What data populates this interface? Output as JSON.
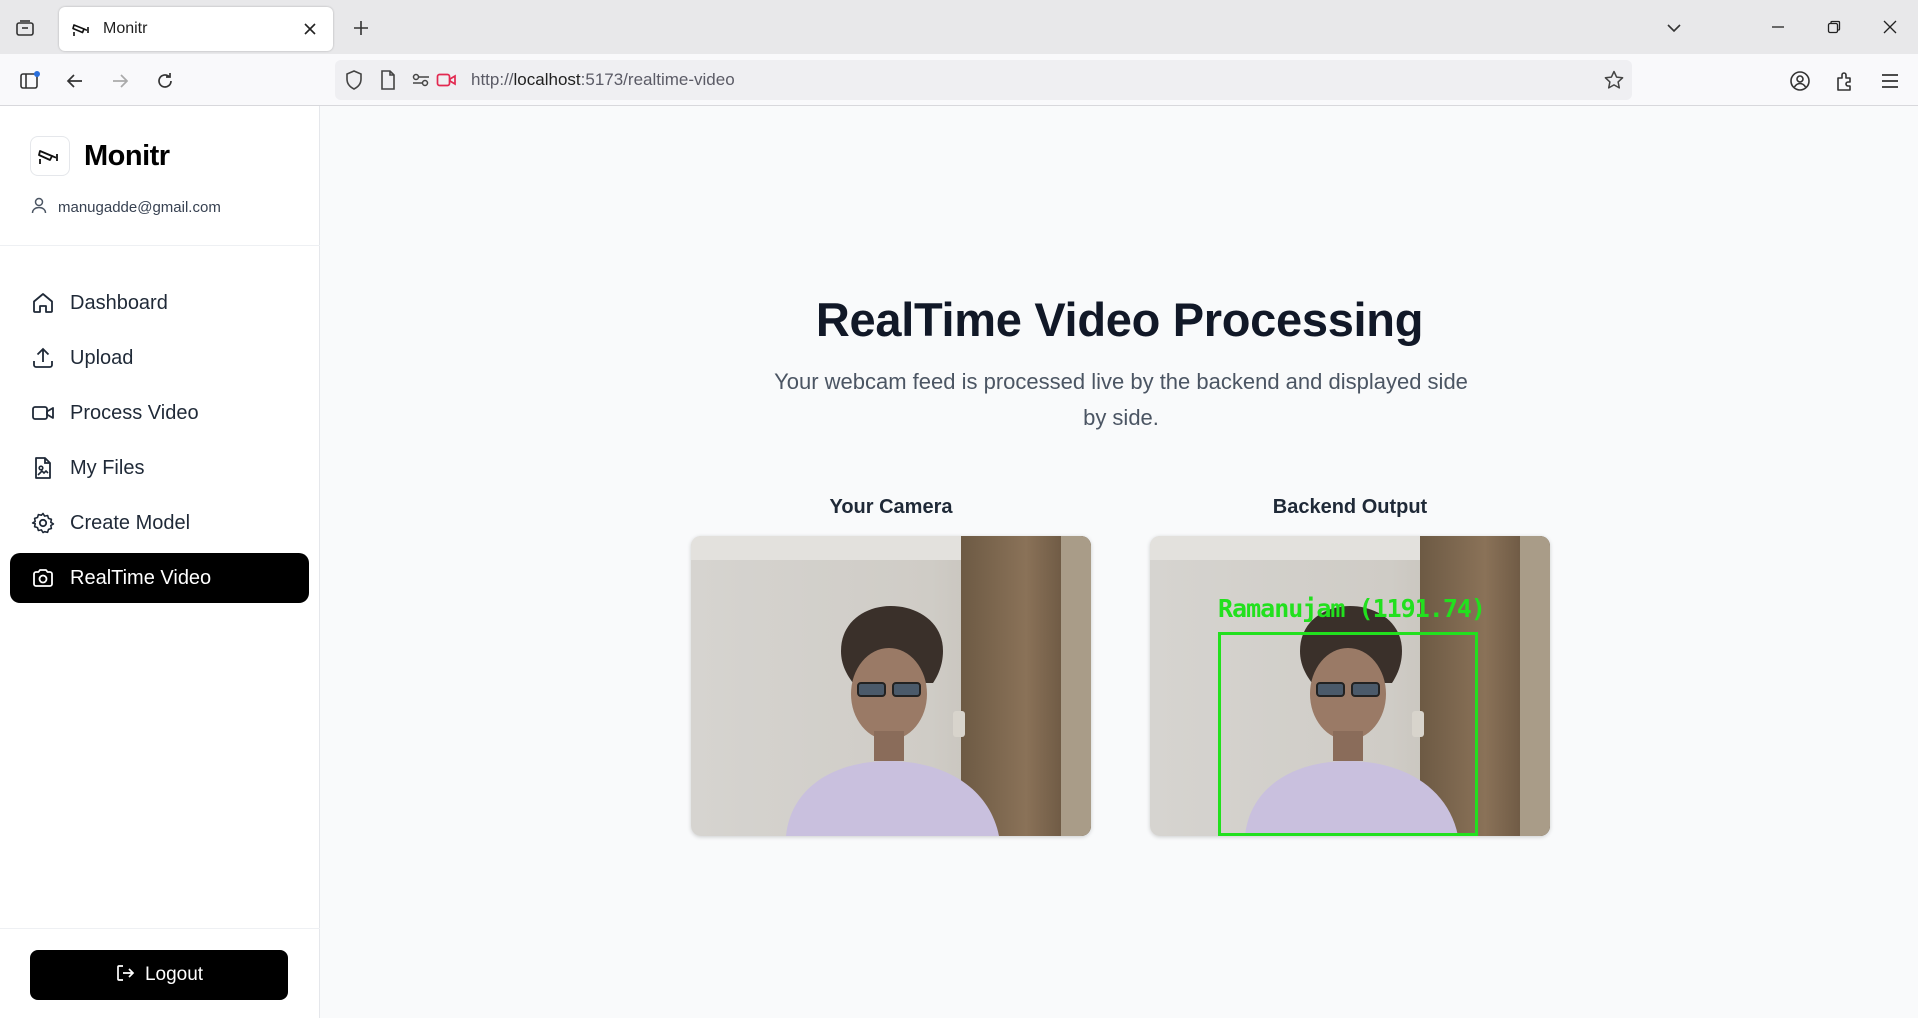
{
  "browser": {
    "tab_title": "Monitr",
    "url_prefix": "http://",
    "url_host": "localhost",
    "url_rest": ":5173/realtime-video"
  },
  "sidebar": {
    "brand": "Monitr",
    "user_email": "manugadde@gmail.com",
    "items": [
      {
        "label": "Dashboard",
        "icon": "home-icon",
        "active": false
      },
      {
        "label": "Upload",
        "icon": "upload-icon",
        "active": false
      },
      {
        "label": "Process Video",
        "icon": "video-camera-icon",
        "active": false
      },
      {
        "label": "My Files",
        "icon": "file-image-icon",
        "active": false
      },
      {
        "label": "Create Model",
        "icon": "gear-icon",
        "active": false
      },
      {
        "label": "RealTime Video",
        "icon": "camera-icon",
        "active": true
      }
    ],
    "logout_label": "Logout"
  },
  "main": {
    "title": "RealTime Video Processing",
    "subtitle": "Your webcam feed is processed live by the backend and displayed side by side.",
    "camera_title": "Your Camera",
    "output_title": "Backend Output",
    "detection_label": "Ramanujam (1191.74)",
    "detection_color": "#22e01e"
  },
  "colors": {
    "active_nav_bg": "#000000",
    "page_bg": "#f9fafb"
  }
}
